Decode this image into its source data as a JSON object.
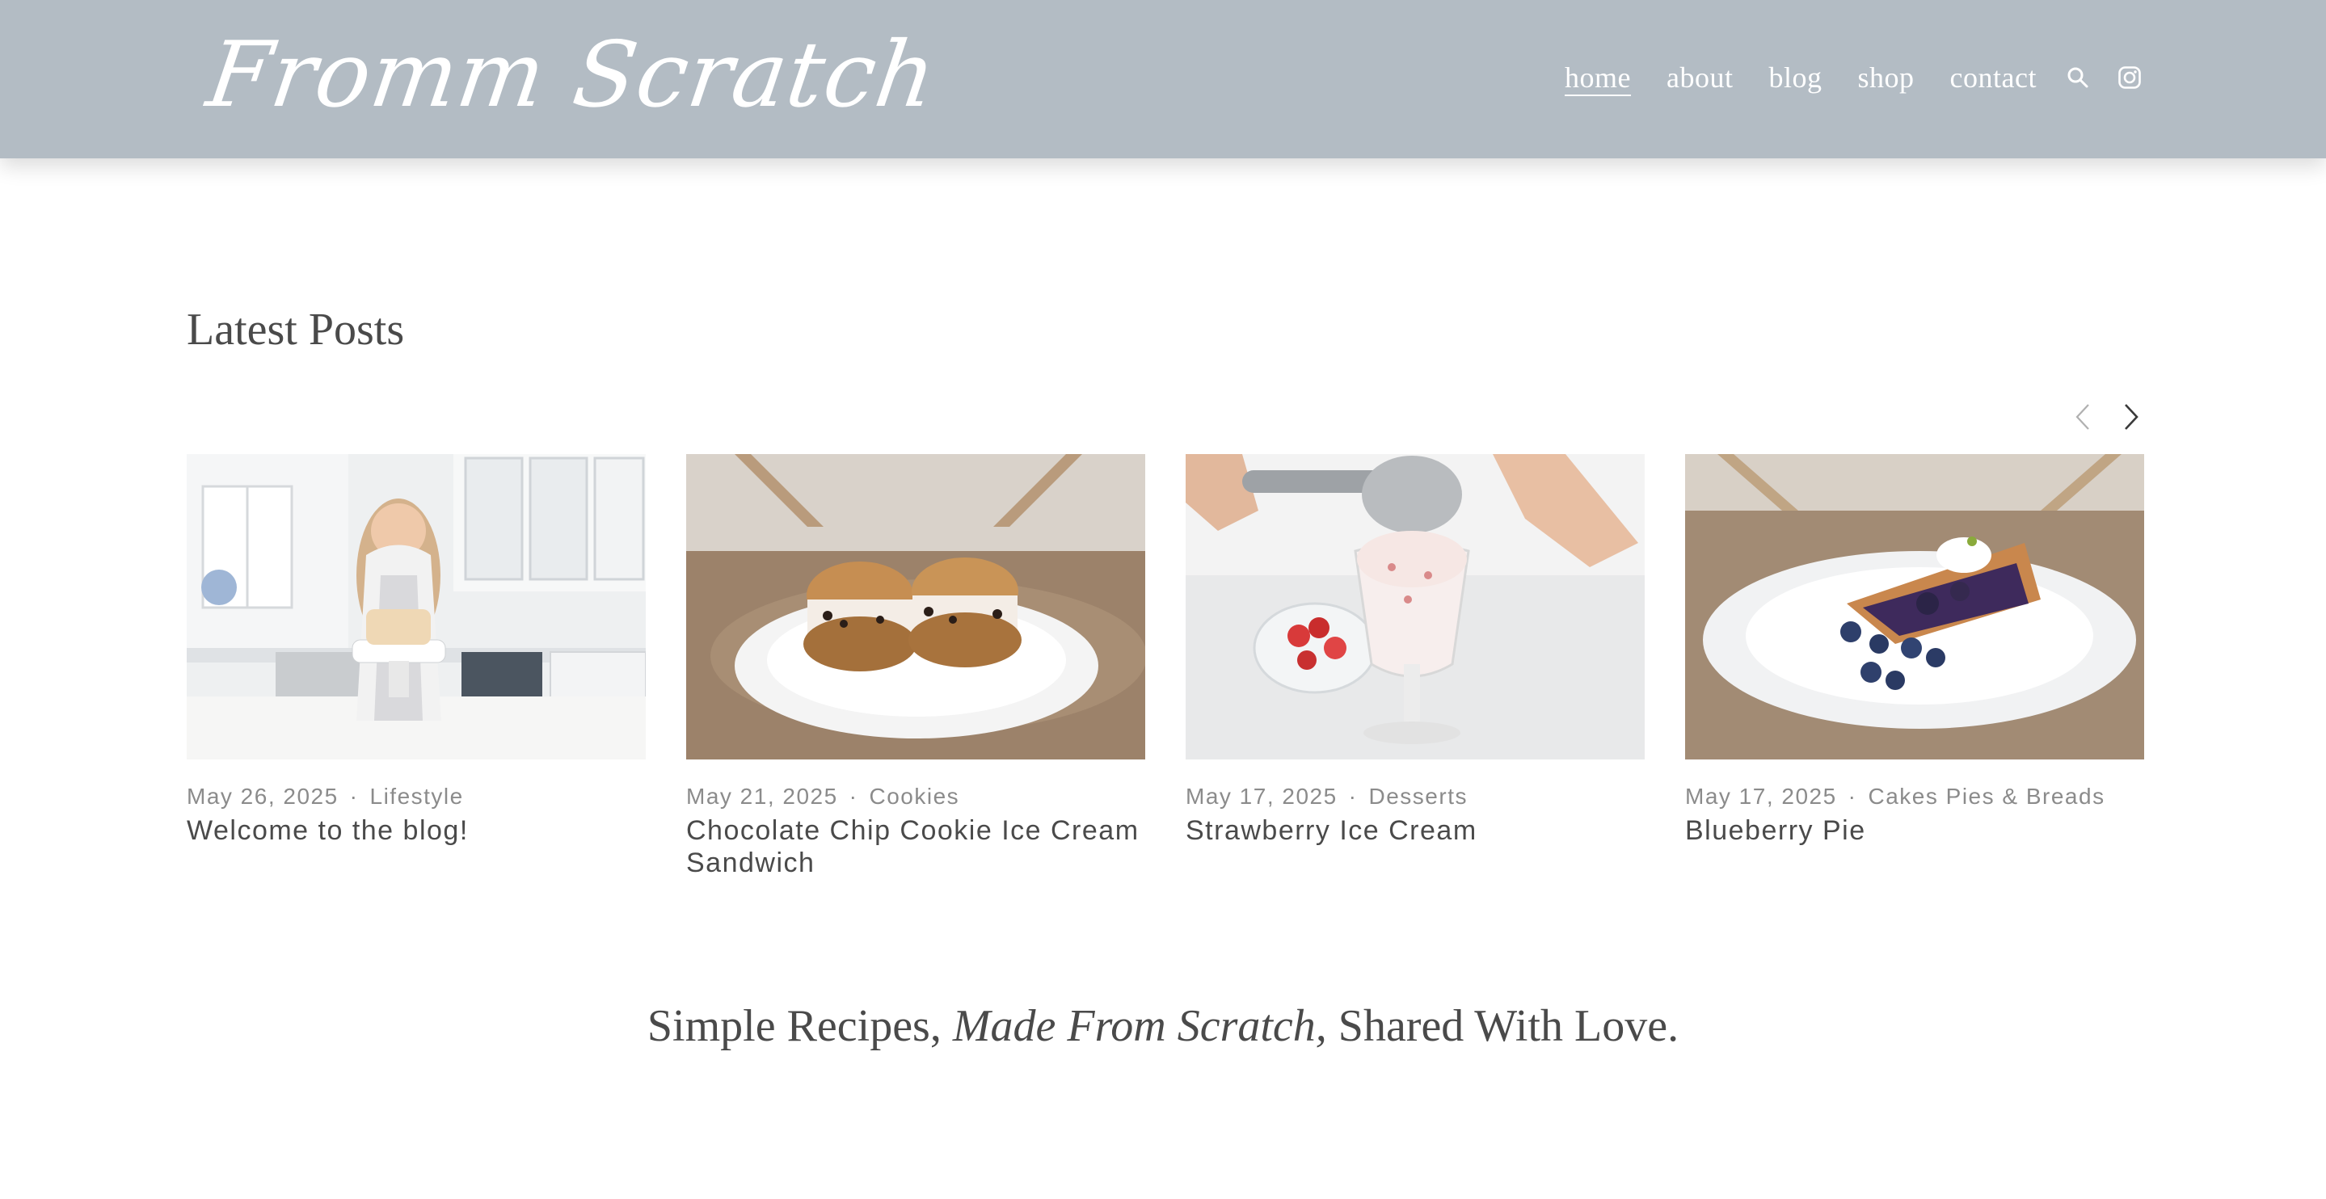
{
  "site": {
    "logo_text": "Fromm Scratch"
  },
  "nav": {
    "items": [
      {
        "label": "home",
        "active": true
      },
      {
        "label": "about",
        "active": false
      },
      {
        "label": "blog",
        "active": false
      },
      {
        "label": "shop",
        "active": false
      },
      {
        "label": "contact",
        "active": false
      }
    ],
    "icons": [
      "search-icon",
      "instagram-icon"
    ]
  },
  "latest": {
    "title": "Latest Posts",
    "posts": [
      {
        "date": "May 26, 2025",
        "category": "Lifestyle",
        "title": "Welcome to the blog!",
        "image": "woman-kitchen-cake-photo"
      },
      {
        "date": "May 21, 2025",
        "category": "Cookies",
        "title": "Chocolate Chip Cookie Ice Cream Sandwich",
        "image": "ice-cream-sandwich-photo"
      },
      {
        "date": "May 17, 2025",
        "category": "Desserts",
        "title": "Strawberry Ice Cream",
        "image": "strawberry-ice-cream-photo"
      },
      {
        "date": "May 17, 2025",
        "category": "Cakes Pies & Breads",
        "title": "Blueberry Pie",
        "image": "blueberry-pie-photo"
      }
    ],
    "separator": "·"
  },
  "tagline": {
    "before": "Simple Recipes, ",
    "italic": "Made From Scratch,",
    "after": " Shared With Love."
  },
  "colors": {
    "header_bg": "#b3bcc4",
    "text": "#4a4a4a",
    "meta": "#8b8b8b"
  }
}
